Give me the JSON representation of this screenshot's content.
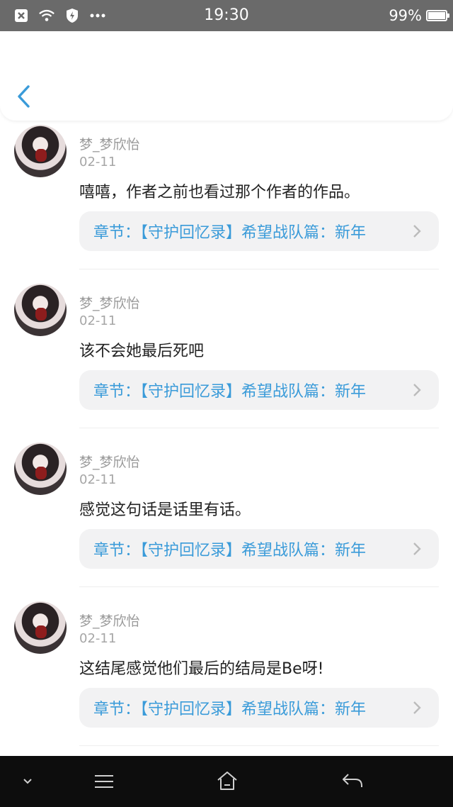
{
  "status_bar": {
    "time": "19:30",
    "battery": "99%",
    "battery_level": 0.99,
    "icons": [
      "close-box-icon",
      "wifi-icon",
      "shield-icon",
      "more-dots-icon"
    ]
  },
  "comments": [
    {
      "name": "梦_梦欣怡",
      "date": "02-11",
      "text": "嘻嘻，作者之前也看过那个作者的作品。",
      "chapter": "章节：【守护回忆录】希望战队篇：新年"
    },
    {
      "name": "梦_梦欣怡",
      "date": "02-11",
      "text": "该不会她最后死吧",
      "chapter": "章节：【守护回忆录】希望战队篇：新年"
    },
    {
      "name": "梦_梦欣怡",
      "date": "02-11",
      "text": "感觉这句话是话里有话。",
      "chapter": "章节：【守护回忆录】希望战队篇：新年"
    },
    {
      "name": "梦_梦欣怡",
      "date": "02-11",
      "text": "这结尾感觉他们最后的结局是Be呀!",
      "chapter": "章节：【守护回忆录】希望战队篇：新年"
    }
  ],
  "colors": {
    "accent": "#3a9bd9",
    "statusbar": "#6a6a6a",
    "navbar": "#0d0d0d"
  },
  "nav_icons": [
    "chevron-down-icon",
    "menu-icon",
    "home-icon",
    "back-arrow-icon"
  ]
}
